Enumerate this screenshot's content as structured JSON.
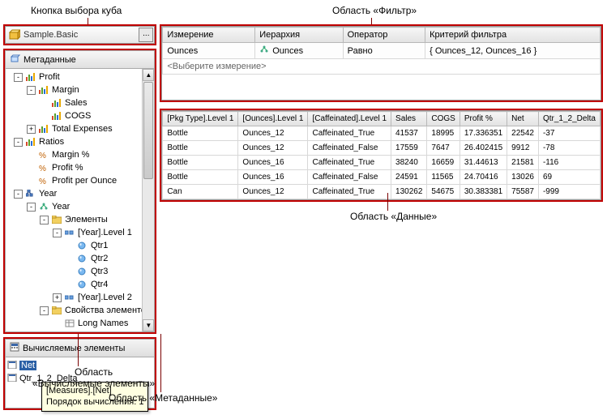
{
  "annotations": {
    "cube_button": "Кнопка выбора куба",
    "filter_area": "Область «Фильтр»",
    "data_area": "Область «Данные»",
    "calc_area": "Область\n«Вычисляемые элементы»",
    "metadata_area": "Область «Метаданные»"
  },
  "cube_selector": {
    "name": "Sample.Basic",
    "browse_label": "..."
  },
  "metadata": {
    "tab_label": "Метаданные",
    "tree": [
      {
        "indent": 0,
        "toggle": "-",
        "icon": "measure",
        "label": "Profit"
      },
      {
        "indent": 1,
        "toggle": "-",
        "icon": "measure",
        "label": "Margin"
      },
      {
        "indent": 2,
        "toggle": "",
        "icon": "measure",
        "label": "Sales"
      },
      {
        "indent": 2,
        "toggle": "",
        "icon": "measure",
        "label": "COGS"
      },
      {
        "indent": 1,
        "toggle": "+",
        "icon": "measure",
        "label": "Total Expenses"
      },
      {
        "indent": 0,
        "toggle": "-",
        "icon": "measure",
        "label": "Ratios"
      },
      {
        "indent": 1,
        "toggle": "",
        "icon": "percent",
        "label": "Margin %"
      },
      {
        "indent": 1,
        "toggle": "",
        "icon": "percent",
        "label": "Profit %"
      },
      {
        "indent": 1,
        "toggle": "",
        "icon": "percent",
        "label": "Profit per Ounce"
      },
      {
        "indent": 0,
        "toggle": "-",
        "icon": "dimension",
        "label": "Year",
        "top": true
      },
      {
        "indent": 1,
        "toggle": "-",
        "icon": "hierarchy",
        "label": "Year"
      },
      {
        "indent": 2,
        "toggle": "-",
        "icon": "folder",
        "label": "Элементы"
      },
      {
        "indent": 3,
        "toggle": "-",
        "icon": "level",
        "label": "[Year].Level 1"
      },
      {
        "indent": 4,
        "toggle": "",
        "icon": "member",
        "label": "Qtr1"
      },
      {
        "indent": 4,
        "toggle": "",
        "icon": "member",
        "label": "Qtr2"
      },
      {
        "indent": 4,
        "toggle": "",
        "icon": "member",
        "label": "Qtr3"
      },
      {
        "indent": 4,
        "toggle": "",
        "icon": "member",
        "label": "Qtr4"
      },
      {
        "indent": 3,
        "toggle": "+",
        "icon": "level",
        "label": "[Year].Level 2"
      },
      {
        "indent": 2,
        "toggle": "-",
        "icon": "folder",
        "label": "Свойства элементов"
      },
      {
        "indent": 3,
        "toggle": "",
        "icon": "property",
        "label": "Long Names"
      }
    ]
  },
  "calc": {
    "header": "Вычисляемые элементы",
    "items": [
      {
        "label": "Net",
        "selected": true
      },
      {
        "label": "Qtr_1_2_Delta",
        "selected": false
      }
    ],
    "tooltip_line1": "[Measures].[Net]",
    "tooltip_line2": "Порядок вычисления: 1"
  },
  "filter": {
    "headers": [
      "Измерение",
      "Иерархия",
      "Оператор",
      "Критерий фильтра"
    ],
    "rows": [
      {
        "dimension": "Ounces",
        "hierarchy": "Ounces",
        "operator": "Равно",
        "criteria": "{ Ounces_12, Ounces_16 }"
      }
    ],
    "prompt": "<Выберите измерение>"
  },
  "data_grid": {
    "headers": [
      "[Pkg Type].Level 1",
      "[Ounces].Level 1",
      "[Caffeinated].Level 1",
      "Sales",
      "COGS",
      "Profit %",
      "Net",
      "Qtr_1_2_Delta"
    ],
    "rows": [
      [
        "Bottle",
        "Ounces_12",
        "Caffeinated_True",
        "41537",
        "18995",
        "17.336351",
        "22542",
        "-37"
      ],
      [
        "Bottle",
        "Ounces_12",
        "Caffeinated_False",
        "17559",
        "7647",
        "26.402415",
        "9912",
        "-78"
      ],
      [
        "Bottle",
        "Ounces_16",
        "Caffeinated_True",
        "38240",
        "16659",
        "31.44613",
        "21581",
        "-116"
      ],
      [
        "Bottle",
        "Ounces_16",
        "Caffeinated_False",
        "24591",
        "11565",
        "24.70416",
        "13026",
        "69"
      ],
      [
        "Can",
        "Ounces_12",
        "Caffeinated_True",
        "130262",
        "54675",
        "30.383381",
        "75587",
        "-999"
      ]
    ]
  }
}
